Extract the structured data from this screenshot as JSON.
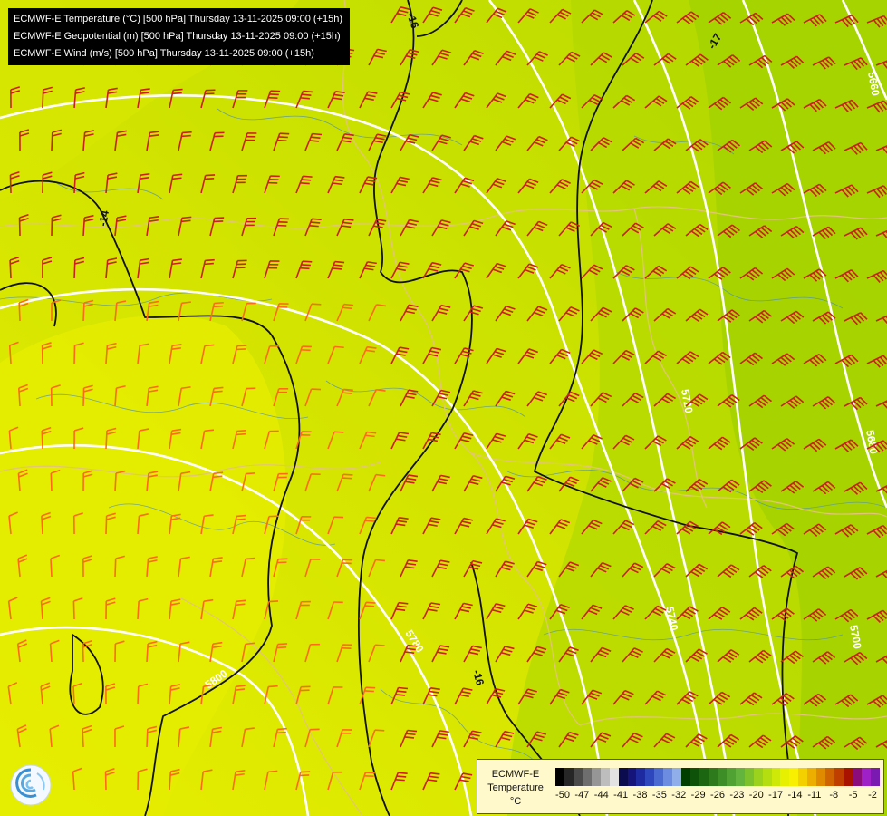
{
  "header": {
    "lines": [
      "ECMWF-E Temperature (°C) [500 hPa] Thursday 13-11-2025 09:00 (+15h)",
      "ECMWF-E Geopotential (m) [500 hPa] Thursday 13-11-2025 09:00 (+15h)",
      "ECMWF-E Wind (m/s) [500 hPa] Thursday 13-11-2025 09:00 (+15h)"
    ]
  },
  "map": {
    "contour_labels": {
      "geopotential": [
        "5660",
        "5700",
        "5740",
        "5780",
        "5800",
        "5680",
        "5720",
        "5740",
        "5780"
      ],
      "temperature": [
        "-16",
        "-17",
        "-14",
        "-16"
      ]
    },
    "colors": {
      "warm_fill": "#ddea00",
      "mid_fill": "#c7e000",
      "cool_fill": "#9ecf00",
      "geopotential_line": "#ffffff",
      "temperature_line": "#111111",
      "border_line": "#e2c47a",
      "river_line": "#4f8fb8",
      "wind_barb_strong": "#cc1f1f",
      "wind_barb_weak": "#ff6a1a"
    }
  },
  "legend": {
    "title_lines": [
      "ECMWF-E",
      "Temperature",
      "°C"
    ],
    "ticks": [
      "-50",
      "-47",
      "-44",
      "-41",
      "-38",
      "-35",
      "-32",
      "-29",
      "-26",
      "-23",
      "-20",
      "-17",
      "-14",
      "-11",
      "-8",
      "-5",
      "-2"
    ],
    "swatches": [
      "#000000",
      "#262626",
      "#4a4a4a",
      "#6e6e6e",
      "#969696",
      "#bdbdbd",
      "#e2e2e2",
      "#0b0b50",
      "#14147a",
      "#1e2aa0",
      "#2e47bc",
      "#4a6ad2",
      "#6b8ce0",
      "#8faeea",
      "#003e00",
      "#0d5208",
      "#1c6612",
      "#2c7a1c",
      "#3d8e26",
      "#50a232",
      "#63b43e",
      "#7cc22c",
      "#9ad21e",
      "#b4de10",
      "#cee808",
      "#e6f000",
      "#f8f000",
      "#f5d000",
      "#eeae00",
      "#e08a00",
      "#d06400",
      "#bf3e00",
      "#aa1200",
      "#8c0c7c",
      "#a020c8",
      "#7a1ab0"
    ]
  },
  "logo": {
    "icon": "ecmwf-swirl-icon"
  }
}
